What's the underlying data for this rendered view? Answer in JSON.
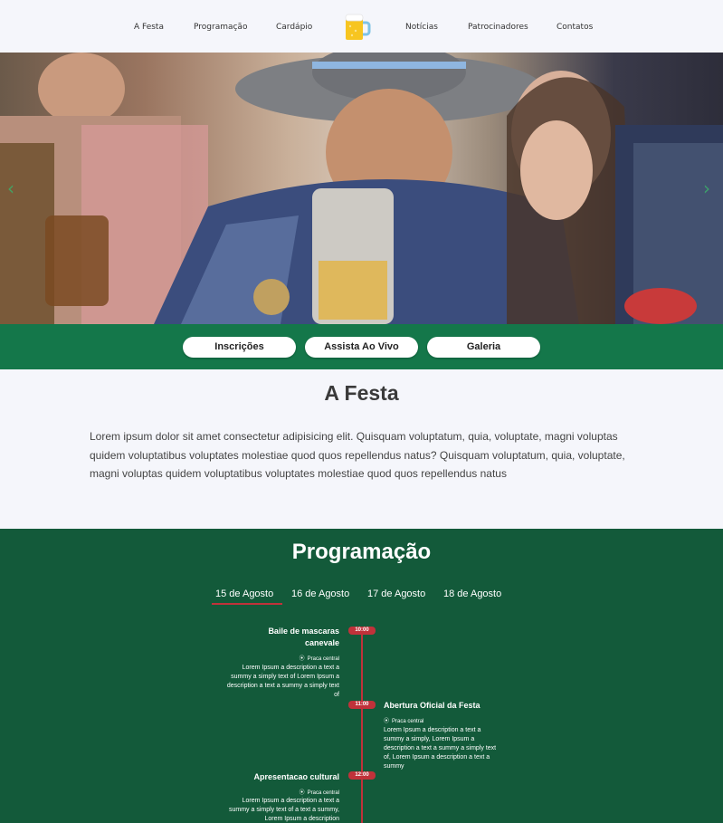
{
  "nav": {
    "items": [
      "A Festa",
      "Programação",
      "Cardápio",
      "Notícias",
      "Patrocinadores",
      "Contatos"
    ],
    "logo_icon": "beer-mug-icon"
  },
  "hero": {
    "prev_icon": "chevron-left-icon",
    "next_icon": "chevron-right-icon",
    "prev_glyph": "‹",
    "next_glyph": "›"
  },
  "cta": {
    "buttons": [
      "Inscrições",
      "Assista Ao Vivo",
      "Galeria"
    ]
  },
  "festa": {
    "title": "A Festa",
    "text": "Lorem ipsum dolor sit amet consectetur adipisicing elit. Quisquam voluptatum, quia, voluptate, magni voluptas quidem voluptatibus voluptates molestiae quod quos repellendus natus? Quisquam voluptatum, quia, voluptate, magni voluptas quidem voluptatibus voluptates molestiae quod quos repellendus natus"
  },
  "programacao": {
    "title": "Programação",
    "tabs": [
      "15 de Agosto",
      "16 de Agosto",
      "17 de Agosto",
      "18 de Agosto"
    ],
    "active_tab": "15 de Agosto",
    "events": [
      {
        "time": "10:00",
        "title": "Baile de mascaras canevale",
        "place": "Praca central",
        "description": "Lorem Ipsum a description a text a summy a simply text of Lorem Ipsum a description a text a summy a simply text of"
      },
      {
        "time": "11:00",
        "title": "Abertura Oficial da Festa",
        "place": "Praca central",
        "description": "Lorem Ipsum a description a text a summy a simply, Lorem Ipsum a description a text a summy a simply text of, Lorem Ipsum a description a text a summy"
      },
      {
        "time": "12:00",
        "title": "Apresentacao cultural",
        "place": "Praca central",
        "description": "Lorem Ipsum a description a text a summy a simply text of a text a summy, Lorem Ipsum a description"
      }
    ]
  },
  "colors": {
    "green_bar": "#14774a",
    "green_section": "#135a3a",
    "accent_red": "#c0323a",
    "background": "#f5f6fb"
  }
}
